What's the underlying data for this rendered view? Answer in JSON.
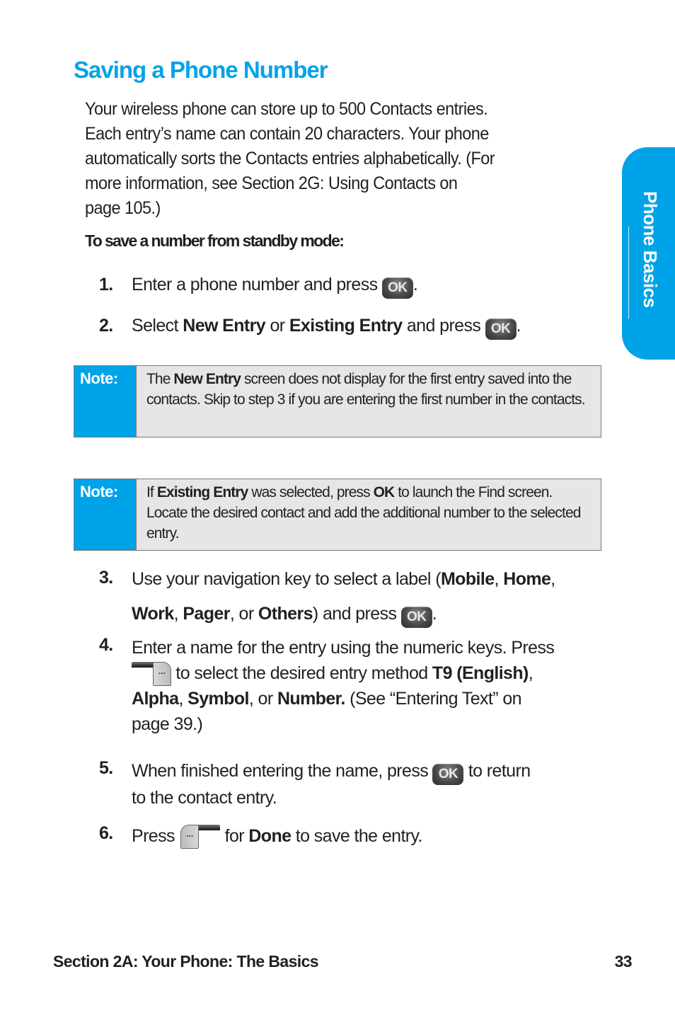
{
  "page": {
    "title": "Saving a Phone Number",
    "intro_lines": [
      "Your wireless phone can store up to 500 Contacts entries.",
      "Each entry’s name can contain 20 characters. Your phone",
      "automatically sorts the Contacts entries alphabetically. (For",
      "more information, see Section 2G: Using Contacts on",
      "page 105.)"
    ],
    "subhead": "To save a number from standby mode:"
  },
  "keys": {
    "ok_label": "OK",
    "softkey_label": "···",
    "ok_key_icon": "ok-key-icon",
    "right_softkey_icon": "right-softkey-icon",
    "left_softkey_icon": "left-softkey-icon"
  },
  "steps": [
    {
      "num": "1.",
      "t1": "Enter a phone number and press ",
      "t2": "."
    },
    {
      "num": "2.",
      "t1": "Select ",
      "b1": "New Entry",
      "t2": " or ",
      "b2": "Existing Entry",
      "t3": " and press ",
      "t4": "."
    },
    {
      "num": "3.",
      "t1": "Use your navigation key to select a label (",
      "b1": "Mobile",
      "t2": ", ",
      "b2": "Home",
      "t3": ",",
      "b3": "Work",
      "t4": ", ",
      "b4": "Pager",
      "t5": ", or ",
      "b5": "Others",
      "t6": ") and press ",
      "t7": "."
    },
    {
      "num": "4.",
      "t1": "Enter a name for the entry using the numeric keys. Press",
      "t2": " to select the desired entry method ",
      "b1": "T9 (English)",
      "t3": ",",
      "b2": "Alpha",
      "t4": ", ",
      "b3": "Symbol",
      "t5": ", or ",
      "b4": "Number.",
      "t6": " (See “Entering Text” on",
      "t7": "page 39.)"
    },
    {
      "num": "5.",
      "t1": "When finished entering the name, press ",
      "t2": " to return",
      "t3": "to the contact entry."
    },
    {
      "num": "6.",
      "t1": "Press ",
      "t2": " for ",
      "b1": "Done",
      "t3": " to save the entry."
    }
  ],
  "notes": [
    {
      "label": "Note:",
      "t1": "The ",
      "b1": "New Entry",
      "t2": " screen does not display for the first entry saved into the contacts. Skip to step 3 if you are entering the first number in the contacts."
    },
    {
      "label": "Note:",
      "t1": "If ",
      "b1": "Existing Entry",
      "t2": " was selected, press ",
      "b2": "OK",
      "t3": " to launch the Find screen. Locate the desired contact and add the additional number to the selected entry."
    }
  ],
  "side_tab": {
    "label": "Phone Basics"
  },
  "footer": {
    "section": "Section 2A: Your Phone: The Basics",
    "page_number": "33"
  },
  "colors": {
    "accent": "#00a3e8",
    "note_bg": "#e6e6e6",
    "text": "#231f20"
  }
}
